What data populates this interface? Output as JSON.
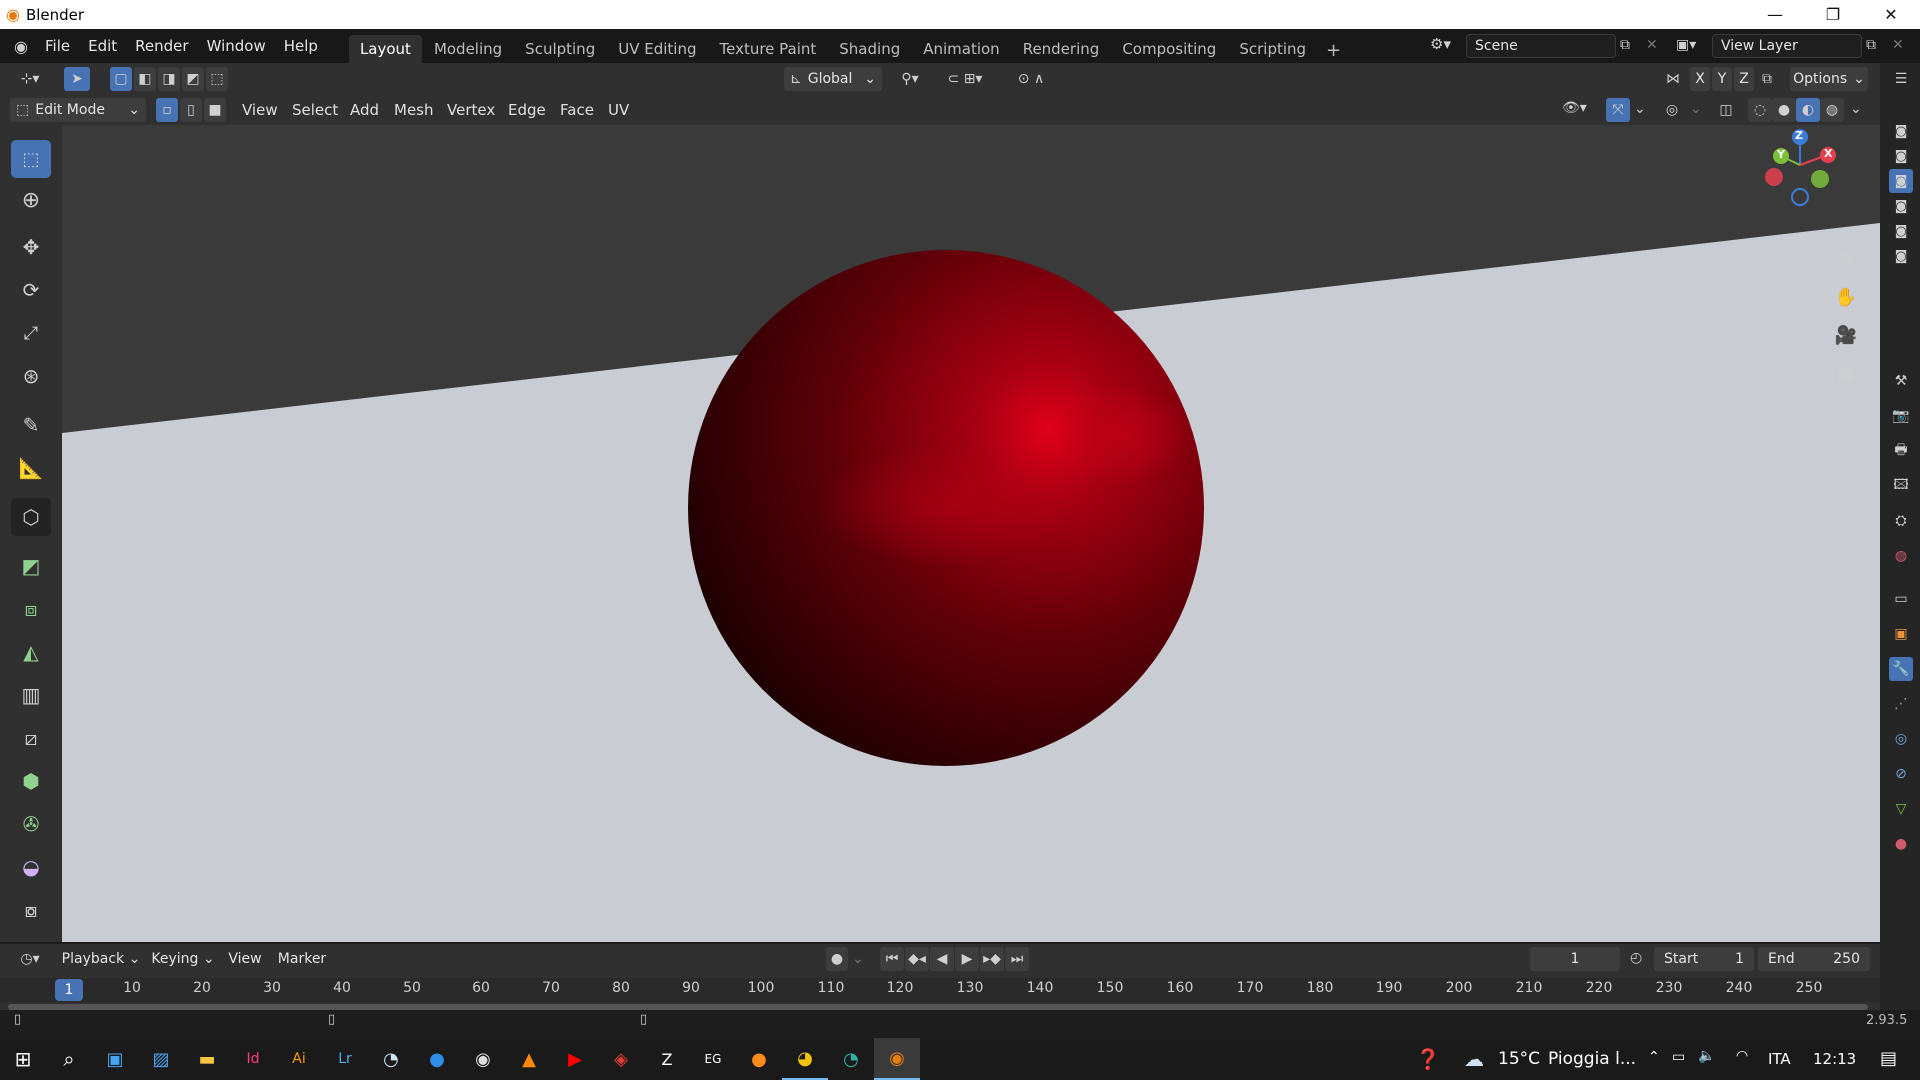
{
  "app": {
    "title": "Blender",
    "version": "2.93.5"
  },
  "menus": [
    "File",
    "Edit",
    "Render",
    "Window",
    "Help"
  ],
  "workspace_tabs": [
    "Layout",
    "Modeling",
    "Sculpting",
    "UV Editing",
    "Texture Paint",
    "Shading",
    "Animation",
    "Rendering",
    "Compositing",
    "Scripting"
  ],
  "active_workspace": "Layout",
  "scene": {
    "name": "Scene",
    "view_layer": "View Layer"
  },
  "header": {
    "transform_orientation": "Global",
    "options_label": "Options",
    "axes": [
      "X",
      "Y",
      "Z"
    ]
  },
  "editor": {
    "mode": "Edit Mode",
    "menus": [
      "View",
      "Select",
      "Add",
      "Mesh",
      "Vertex",
      "Edge",
      "Face",
      "UV"
    ]
  },
  "gizmo": {
    "x": "X",
    "y": "Y",
    "z": "Z"
  },
  "timeline": {
    "menus": [
      "Playback",
      "Keying",
      "View",
      "Marker"
    ],
    "current_frame": "1",
    "start_label": "Start",
    "start": "1",
    "end_label": "End",
    "end": "250",
    "ticks": [
      "10",
      "20",
      "30",
      "40",
      "50",
      "60",
      "70",
      "80",
      "90",
      "100",
      "110",
      "120",
      "130",
      "140",
      "150",
      "160",
      "170",
      "180",
      "190",
      "200",
      "210",
      "220",
      "230",
      "240",
      "250"
    ],
    "playhead": "1"
  },
  "taskbar": {
    "weather": "15°C",
    "weather_text": "Pioggia l...",
    "language": "ITA",
    "time": "12:13"
  },
  "colors": {
    "accent": "#4772b3",
    "sphere": "#8a0010",
    "floor": "#c9ccd3",
    "background": "#3a3a3a"
  }
}
